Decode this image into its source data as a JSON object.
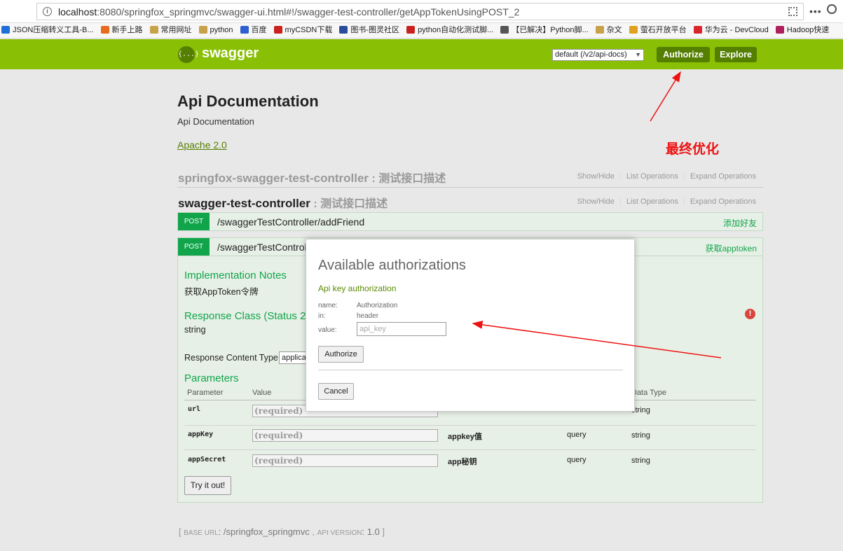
{
  "browser": {
    "url_host": "localhost",
    "url_rest": ":8080/springfox_springmvc/swagger-ui.html#!/swagger-test-controller/getAppTokenUsingPOST_2",
    "bookmarks": [
      {
        "label": "JSON压缩转义工具-B...",
        "color": "#1e6fd9"
      },
      {
        "label": "新手上路",
        "color": "#e86a1c"
      },
      {
        "label": "常用网址",
        "color": "#c8a24a"
      },
      {
        "label": "python",
        "color": "#c8a24a"
      },
      {
        "label": "百度",
        "color": "#2f5fd0"
      },
      {
        "label": "myCSDN下载",
        "color": "#c9221d"
      },
      {
        "label": "图书-图灵社区",
        "color": "#2a4d9b"
      },
      {
        "label": "python自动化测试脚...",
        "color": "#c9221d"
      },
      {
        "label": "【已解决】Python脚...",
        "color": "#555555"
      },
      {
        "label": "杂文",
        "color": "#c8a24a"
      },
      {
        "label": "萤石开放平台",
        "color": "#e0a020"
      },
      {
        "label": "华为云 - DevCloud",
        "color": "#d8262c"
      },
      {
        "label": "Hadoop快速",
        "color": "#b01e5c"
      }
    ]
  },
  "header": {
    "logo_icon": "{...}",
    "logo_text": "swagger",
    "spec_select": "default (/v2/api-docs)",
    "authorize_label": "Authorize",
    "explore_label": "Explore",
    "brand_color": "#89bf04"
  },
  "info": {
    "title": "Api Documentation",
    "description": "Api Documentation",
    "license": "Apache 2.0"
  },
  "annotation": {
    "text": "最终优化",
    "color": "#ee1111"
  },
  "resources": [
    {
      "name": "springfox-swagger-test-controller",
      "desc": " : 测试接口描述",
      "ops": [
        "Show/Hide",
        "List Operations",
        "Expand Operations"
      ]
    },
    {
      "name": "swagger-test-controller",
      "desc": " : 测试接口描述",
      "ops": [
        "Show/Hide",
        "List Operations",
        "Expand Operations"
      ]
    }
  ],
  "operations": [
    {
      "verb": "POST",
      "path": "/swaggerTestController/addFriend",
      "summary": "添加好友"
    },
    {
      "verb": "POST",
      "path": "/swaggerTestControl",
      "summary": "获取apptoken"
    }
  ],
  "op_body": {
    "impl_notes_title": "Implementation Notes",
    "impl_notes": "获取AppToken令牌",
    "response_class_title": "Response Class (Status 200)",
    "response_class": "string",
    "content_type_label": "Response Content Type",
    "content_type_value": "applica",
    "params_title": "Parameters",
    "columns": [
      "Parameter",
      "Value",
      "Data Type"
    ],
    "params": [
      {
        "name": "url",
        "placeholder": "(required)",
        "desc": "",
        "type": "",
        "dtype": "string"
      },
      {
        "name": "appKey",
        "placeholder": "(required)",
        "desc": "appkey值",
        "type": "query",
        "dtype": "string"
      },
      {
        "name": "appSecret",
        "placeholder": "(required)",
        "desc": "app秘钥",
        "type": "query",
        "dtype": "string"
      }
    ],
    "try_label": "Try it out!",
    "error_icon": "!"
  },
  "footer": {
    "open": "[ ",
    "base_url_label": "BASE URL",
    "base_url": ": /springfox_springmvc",
    "sep": " , ",
    "version_label": "API VERSION",
    "version": ": 1.0",
    "close": " ]"
  },
  "modal": {
    "title": "Available authorizations",
    "subtitle": "Api key authorization",
    "name_label": "name:",
    "name_value": "Authorization",
    "in_label": "in:",
    "in_value": "header",
    "value_label": "value:",
    "value_placeholder": "api_key",
    "authorize_label": "Authorize",
    "cancel_label": "Cancel"
  }
}
